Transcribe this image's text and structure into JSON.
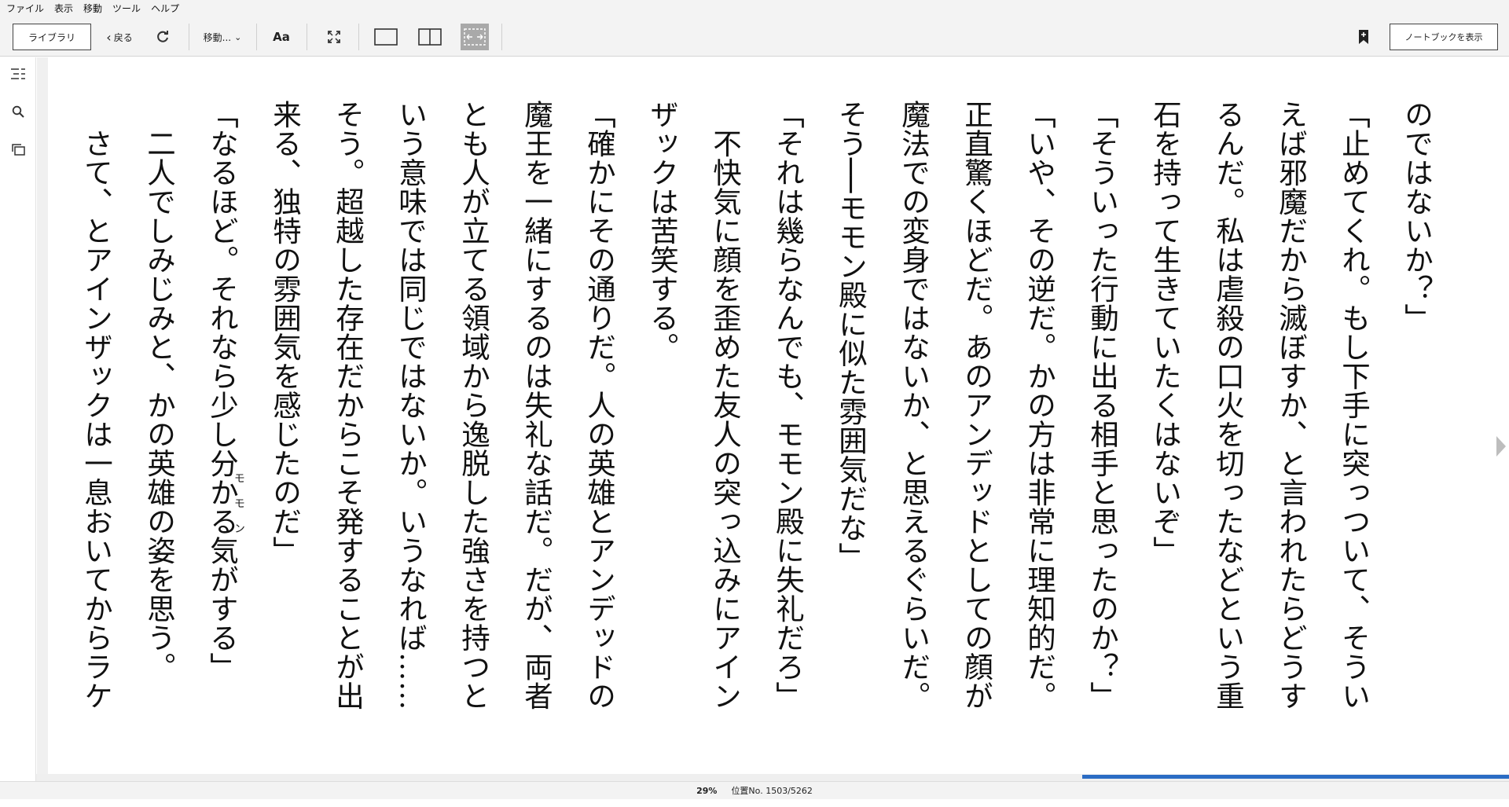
{
  "menu": [
    "ファイル",
    "表示",
    "移動",
    "ツール",
    "ヘルプ"
  ],
  "toolbar": {
    "library_label": "ライブラリ",
    "back_label": "戻る",
    "goto_label": "移動...",
    "font_label": "Aa",
    "notebook_label": "ノートブックを表示"
  },
  "icons": {
    "refresh": "refresh-icon",
    "fullscreen": "fullscreen-icon",
    "single_page": "single-page-icon",
    "two_page": "two-page-icon",
    "fit_width": "fit-width-icon",
    "bookmark": "bookmark-add-icon",
    "toc": "toc-icon",
    "search": "search-icon",
    "flashcards": "flashcards-icon",
    "next": "next-page-icon"
  },
  "book": {
    "lines": [
      "のではないか？」",
      "「止めてくれ。もし下手に突っついて、そうい",
      "えば邪魔だから滅ぼすか、と言われたらどうす",
      "るんだ。私は虐殺の口火を切ったなどという重",
      "石を持って生きていたくはないぞ」",
      "「そういった行動に出る相手と思ったのか？」",
      "「いや、その逆だ。かの方は非常に理知的だ。",
      "正直驚くほどだ。あのアンデッドとしての顔が",
      "魔法での変身ではないか、と思えるぐらいだ。",
      "そう──モモン殿に似た雰囲気だな」",
      "「それは幾らなんでも、モモン殿に失礼だろ」",
      "　不快気に顔を歪めた友人の突っ込みにアイン",
      "ザックは苦笑する。",
      "「確かにその通りだ。人の英雄とアンデッドの",
      "魔王を一緒にするのは失礼な話だ。だが、両者",
      "とも人が立てる領域から逸脱した強さを持つと",
      "いう意味では同じではないか。いうなれば……",
      "そう。超越した存在だからこそ発することが出",
      "来る、独特の雰囲気を感じたのだ」",
      "「なるほど。それなら少し分かる気がする」",
      "　二人でしみじみと、かの英雄の姿を思う。",
      "　さて、とアインザックは一息おいてからラケ"
    ],
    "ruby": "モモン"
  },
  "status": {
    "percent": "29%",
    "location": "位置No. 1503/5262",
    "progress": 0.29
  },
  "colors": {
    "accent": "#2b6cc4",
    "toolbar_bg": "#f3f3f3",
    "active_button": "#a9a9a9"
  }
}
